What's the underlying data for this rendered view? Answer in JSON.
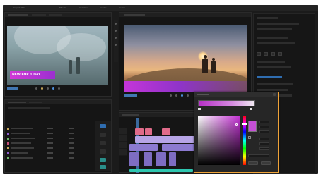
{
  "menu": {
    "items": [
      {
        "label": "Project: Edit"
      },
      {
        "label": "Effects"
      },
      {
        "label": "Graphics"
      },
      {
        "label": "Audio"
      },
      {
        "label": "Color"
      }
    ]
  },
  "source_monitor": {
    "title_card": "NEW FOR 1 DAY"
  },
  "colors": {
    "accent": "#4c8ed9",
    "title_bar": "#c435d9",
    "dialog_border": "#f0a338",
    "selected_color": "#c54fd6"
  },
  "color_picker": {
    "icons": [
      "hue-strip",
      "saturation-field",
      "swatch"
    ]
  }
}
